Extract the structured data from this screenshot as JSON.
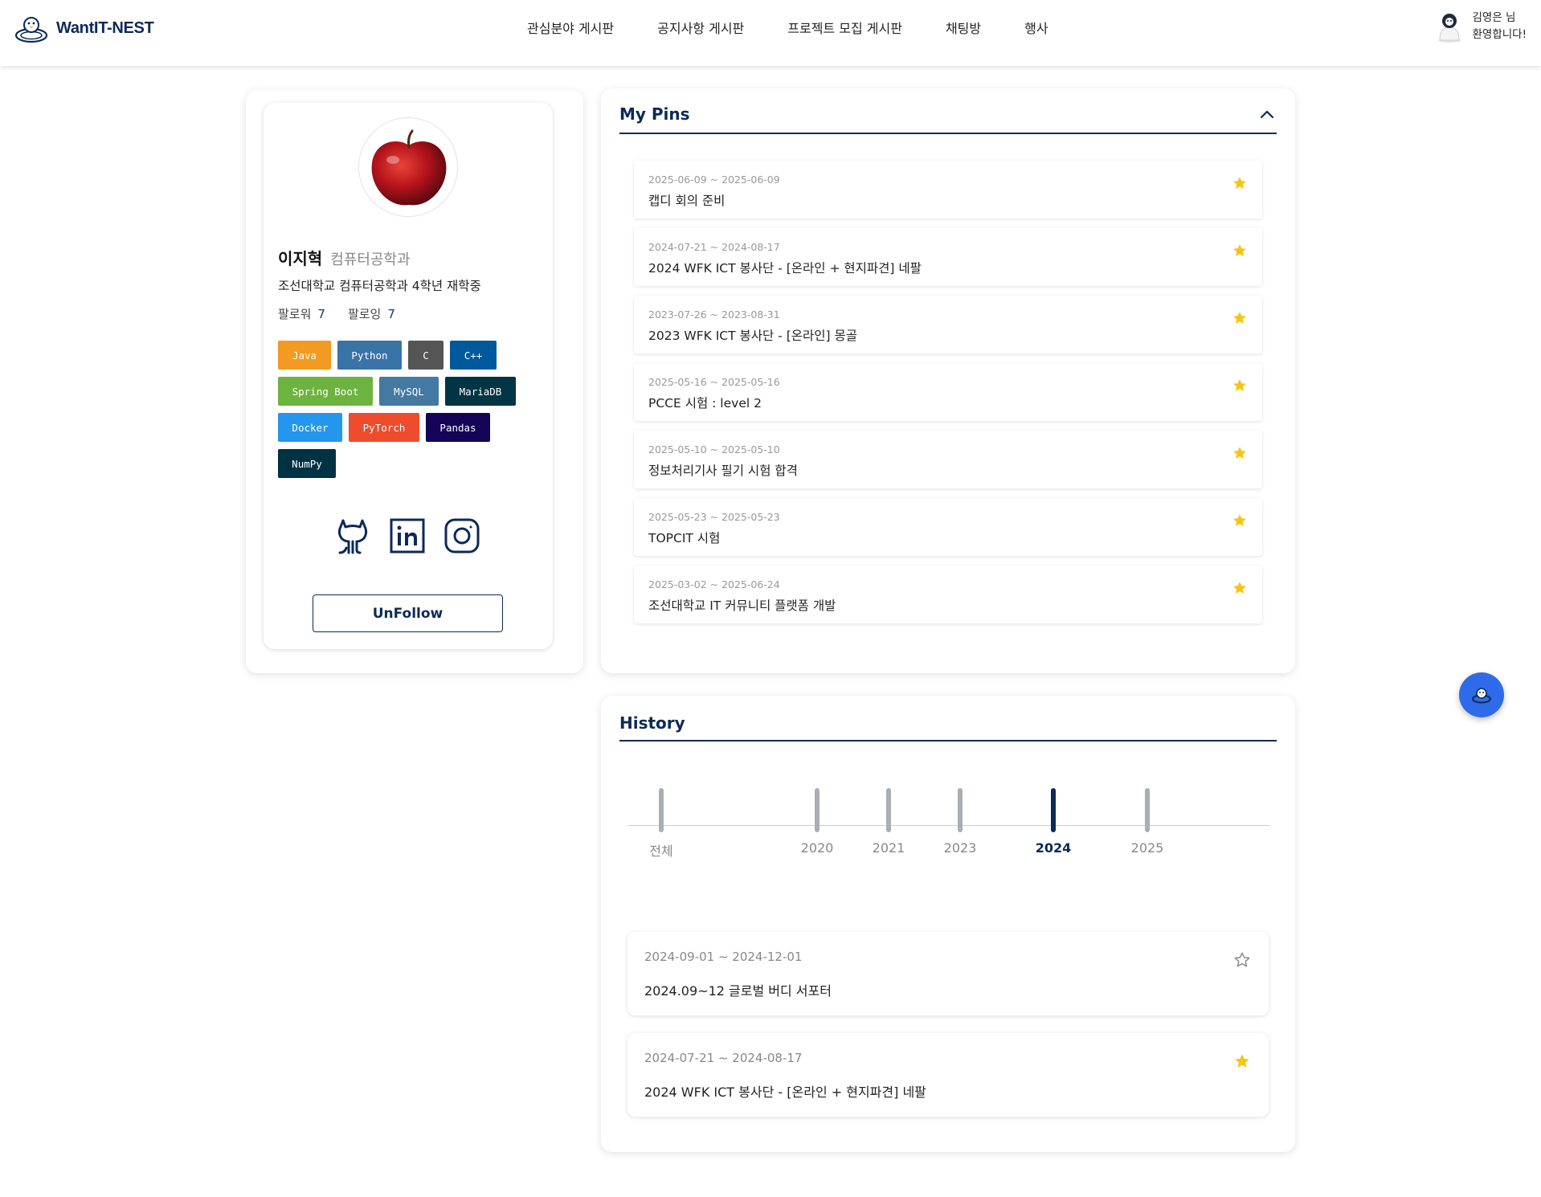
{
  "header": {
    "logo_text": "WantIT-NEST",
    "nav": [
      "관심분야 게시판",
      "공지사항 게시판",
      "프로젝트 모집 게시판",
      "채팅방",
      "행사"
    ],
    "user_line1": "김영은 님",
    "user_line2": "환영합니다!"
  },
  "profile": {
    "name": "이지혁",
    "dept": "컴퓨터공학과",
    "desc": "조선대학교 컴퓨터공학과 4학년 재학중",
    "follower_label": "팔로워",
    "follower_count": "7",
    "following_label": "팔로잉",
    "following_count": "7",
    "tags": [
      {
        "label": "Java",
        "color": "#f29a21"
      },
      {
        "label": "Python",
        "color": "#3a73a8"
      },
      {
        "label": "C",
        "color": "#555555"
      },
      {
        "label": "C++",
        "color": "#00599c"
      },
      {
        "label": "Spring Boot",
        "color": "#6db33f"
      },
      {
        "label": "MySQL",
        "color": "#4479a1"
      },
      {
        "label": "MariaDB",
        "color": "#003545"
      },
      {
        "label": "Docker",
        "color": "#2496ed"
      },
      {
        "label": "PyTorch",
        "color": "#ee4c2c"
      },
      {
        "label": "Pandas",
        "color": "#150458"
      },
      {
        "label": "NumPy",
        "color": "#013243"
      }
    ],
    "socials": [
      "github-icon",
      "linkedin-icon",
      "instagram-icon"
    ],
    "unfollow_label": "UnFollow"
  },
  "pins": {
    "title": "My Pins",
    "items": [
      {
        "date": "2025-06-09 ~ 2025-06-09",
        "title": "캡디 회의 준비"
      },
      {
        "date": "2024-07-21 ~ 2024-08-17",
        "title": "2024 WFK ICT 봉사단 - [온라인 + 현지파견] 네팔"
      },
      {
        "date": "2023-07-26 ~ 2023-08-31",
        "title": "2023 WFK ICT 봉사단 - [온라인] 몽골"
      },
      {
        "date": "2025-05-16 ~ 2025-05-16",
        "title": "PCCE 시험 : level 2"
      },
      {
        "date": "2025-05-10 ~ 2025-05-10",
        "title": "정보처리기사 필기 시험 합격"
      },
      {
        "date": "2025-05-23 ~ 2025-05-23",
        "title": "TOPCIT 시험"
      },
      {
        "date": "2025-03-02 ~ 2025-06-24",
        "title": "조선대학교 IT 커뮤니티 플랫폼 개발"
      }
    ]
  },
  "history": {
    "title": "History",
    "timeline": [
      {
        "label": "전체",
        "active": false
      },
      {
        "label": "2020",
        "active": false
      },
      {
        "label": "2021",
        "active": false
      },
      {
        "label": "2023",
        "active": false
      },
      {
        "label": "2024",
        "active": true
      },
      {
        "label": "2025",
        "active": false
      }
    ],
    "items": [
      {
        "date": "2024-09-01 ~ 2024-12-01",
        "title": "2024.09~12 글로벌 버디 서포터",
        "pinned": false
      },
      {
        "date": "2024-07-21 ~ 2024-08-17",
        "title": "2024 WFK ICT 봉사단 - [온라인 + 현지파견] 네팔",
        "pinned": true
      }
    ]
  },
  "colors": {
    "primary": "#0b2a57",
    "star": "#f5c518",
    "fab": "#2f6be8"
  }
}
